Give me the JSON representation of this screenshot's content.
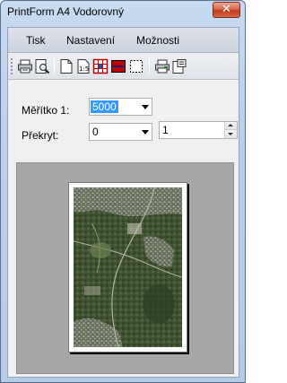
{
  "window": {
    "title": "PrintForm A4  Vodorovný",
    "close_label": "✕"
  },
  "menu": {
    "items": [
      {
        "label": "Tisk"
      },
      {
        "label": "Nastavení"
      },
      {
        "label": "Možnosti"
      }
    ]
  },
  "toolbar": {
    "icons": [
      "print-icon",
      "print-preview-icon",
      "new-page-icon",
      "page-size-icon",
      "grid-red-icon",
      "fill-red-icon",
      "frame-select-icon",
      "printer-setup-icon",
      "page-setup-icon"
    ]
  },
  "form": {
    "scale_label": "Měřítko 1:",
    "scale_value": "5000",
    "overlap_label": "Překryt:",
    "overlap_value": "0",
    "spin_value": "1"
  },
  "colors": {
    "accent_selection": "#3399ff",
    "preview_background": "#a7a7a7",
    "close_button": "#c13a18"
  }
}
